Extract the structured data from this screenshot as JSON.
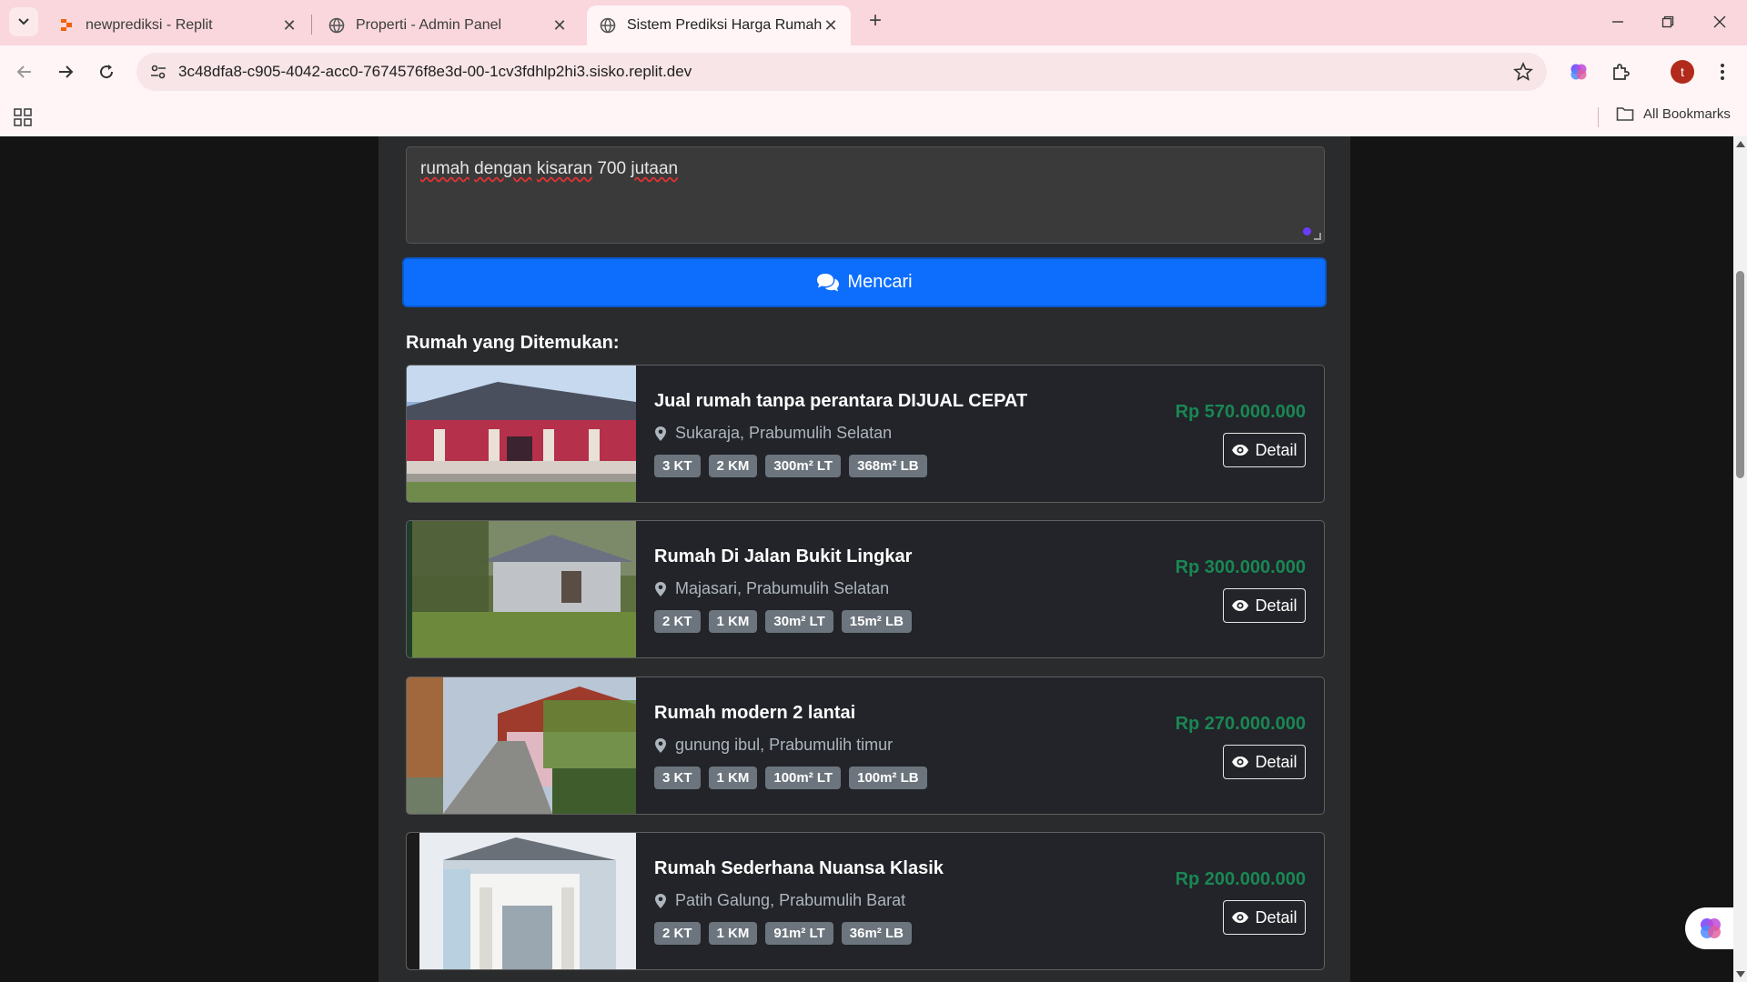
{
  "browser": {
    "tabs": [
      {
        "title": "newprediksi - Replit",
        "icon": "replit-icon"
      },
      {
        "title": "Properti - Admin Panel",
        "icon": "globe-icon"
      },
      {
        "title": "Sistem Prediksi Harga Rumah",
        "icon": "globe-icon",
        "active": true
      }
    ],
    "url": "3c48dfa8-c905-4042-acc0-7674576f8e3d-00-1cv3fdhlp2hi3.sisko.replit.dev",
    "profile_initial": "t",
    "all_bookmarks": "All Bookmarks"
  },
  "search": {
    "query_parts": [
      "rumah",
      " ",
      "dengan",
      " ",
      "kisaran",
      " 700 ",
      "jutaan"
    ],
    "button_label": "Mencari"
  },
  "results": {
    "heading": "Rumah yang Ditemukan:",
    "detail_label": "Detail",
    "items": [
      {
        "title": "Jual rumah tanpa perantara DIJUAL CEPAT",
        "location": "Sukaraja, Prabumulih Selatan",
        "badges": [
          "3 KT",
          "2 KM",
          "300m² LT",
          "368m² LB"
        ],
        "price": "Rp 570.000.000"
      },
      {
        "title": "Rumah Di Jalan Bukit Lingkar",
        "location": "Majasari, Prabumulih Selatan",
        "badges": [
          "2 KT",
          "1 KM",
          "30m² LT",
          "15m² LB"
        ],
        "price": "Rp 300.000.000"
      },
      {
        "title": "Rumah modern 2 lantai",
        "location": "gunung ibul, Prabumulih timur",
        "badges": [
          "3 KT",
          "1 KM",
          "100m² LT",
          "100m² LB"
        ],
        "price": "Rp 270.000.000"
      },
      {
        "title": "Rumah Sederhana Nuansa Klasik",
        "location": "Patih Galung, Prabumulih Barat",
        "badges": [
          "2 KT",
          "1 KM",
          "91m² LT",
          "36m² LB"
        ],
        "price": "Rp 200.000.000"
      }
    ]
  },
  "colors": {
    "primary": "#0d6efd",
    "price": "#198754",
    "badge": "#6c757d",
    "card_bg": "#222429"
  }
}
